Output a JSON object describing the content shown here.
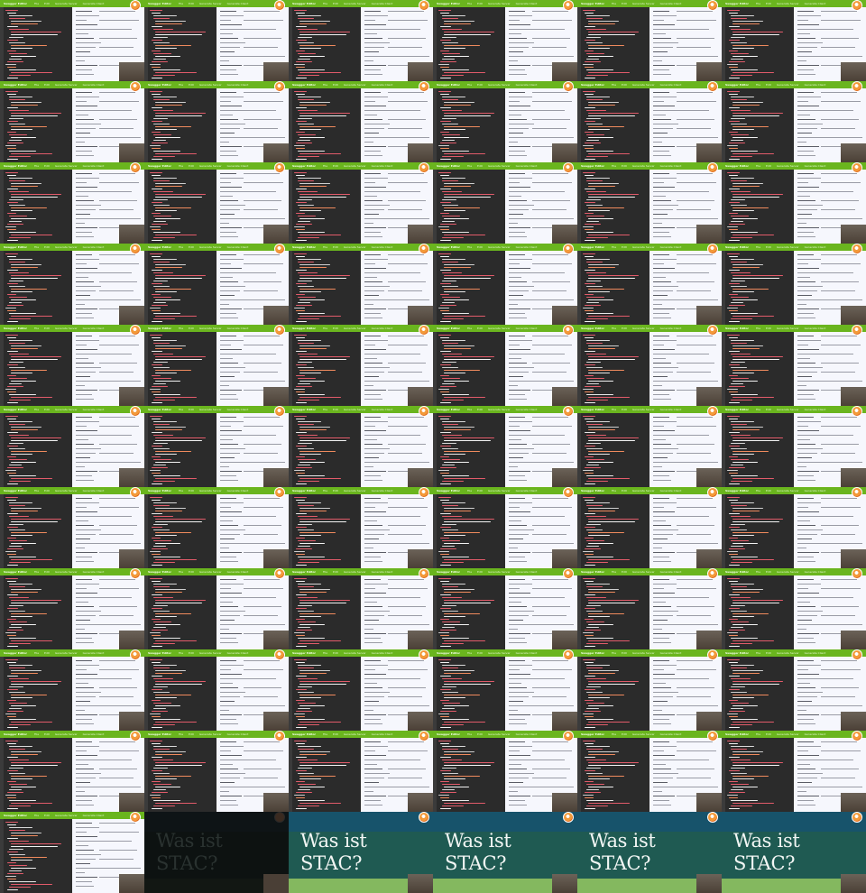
{
  "grid": {
    "columns": 6,
    "rows": 11,
    "editor_tile_count": 61,
    "title_tile_count": 5
  },
  "editor_tile": {
    "app_name": "Swagger Editor",
    "menu_items": [
      "File",
      "Edit",
      "Generate Server",
      "Generate Client"
    ],
    "logo_icon": "swagger-logo-icon",
    "webcam_label": "presenter webcam"
  },
  "title_slide": {
    "title": "Was ist\nSTAC?",
    "dark_first": true
  },
  "colors": {
    "menubar": "#6ab51e",
    "editor_bg": "#2b2b2b",
    "preview_bg": "#f6f7fd",
    "slide_teal": "#1f5a52",
    "slide_top": "#17536b",
    "slide_bottom": "#84b85f"
  }
}
